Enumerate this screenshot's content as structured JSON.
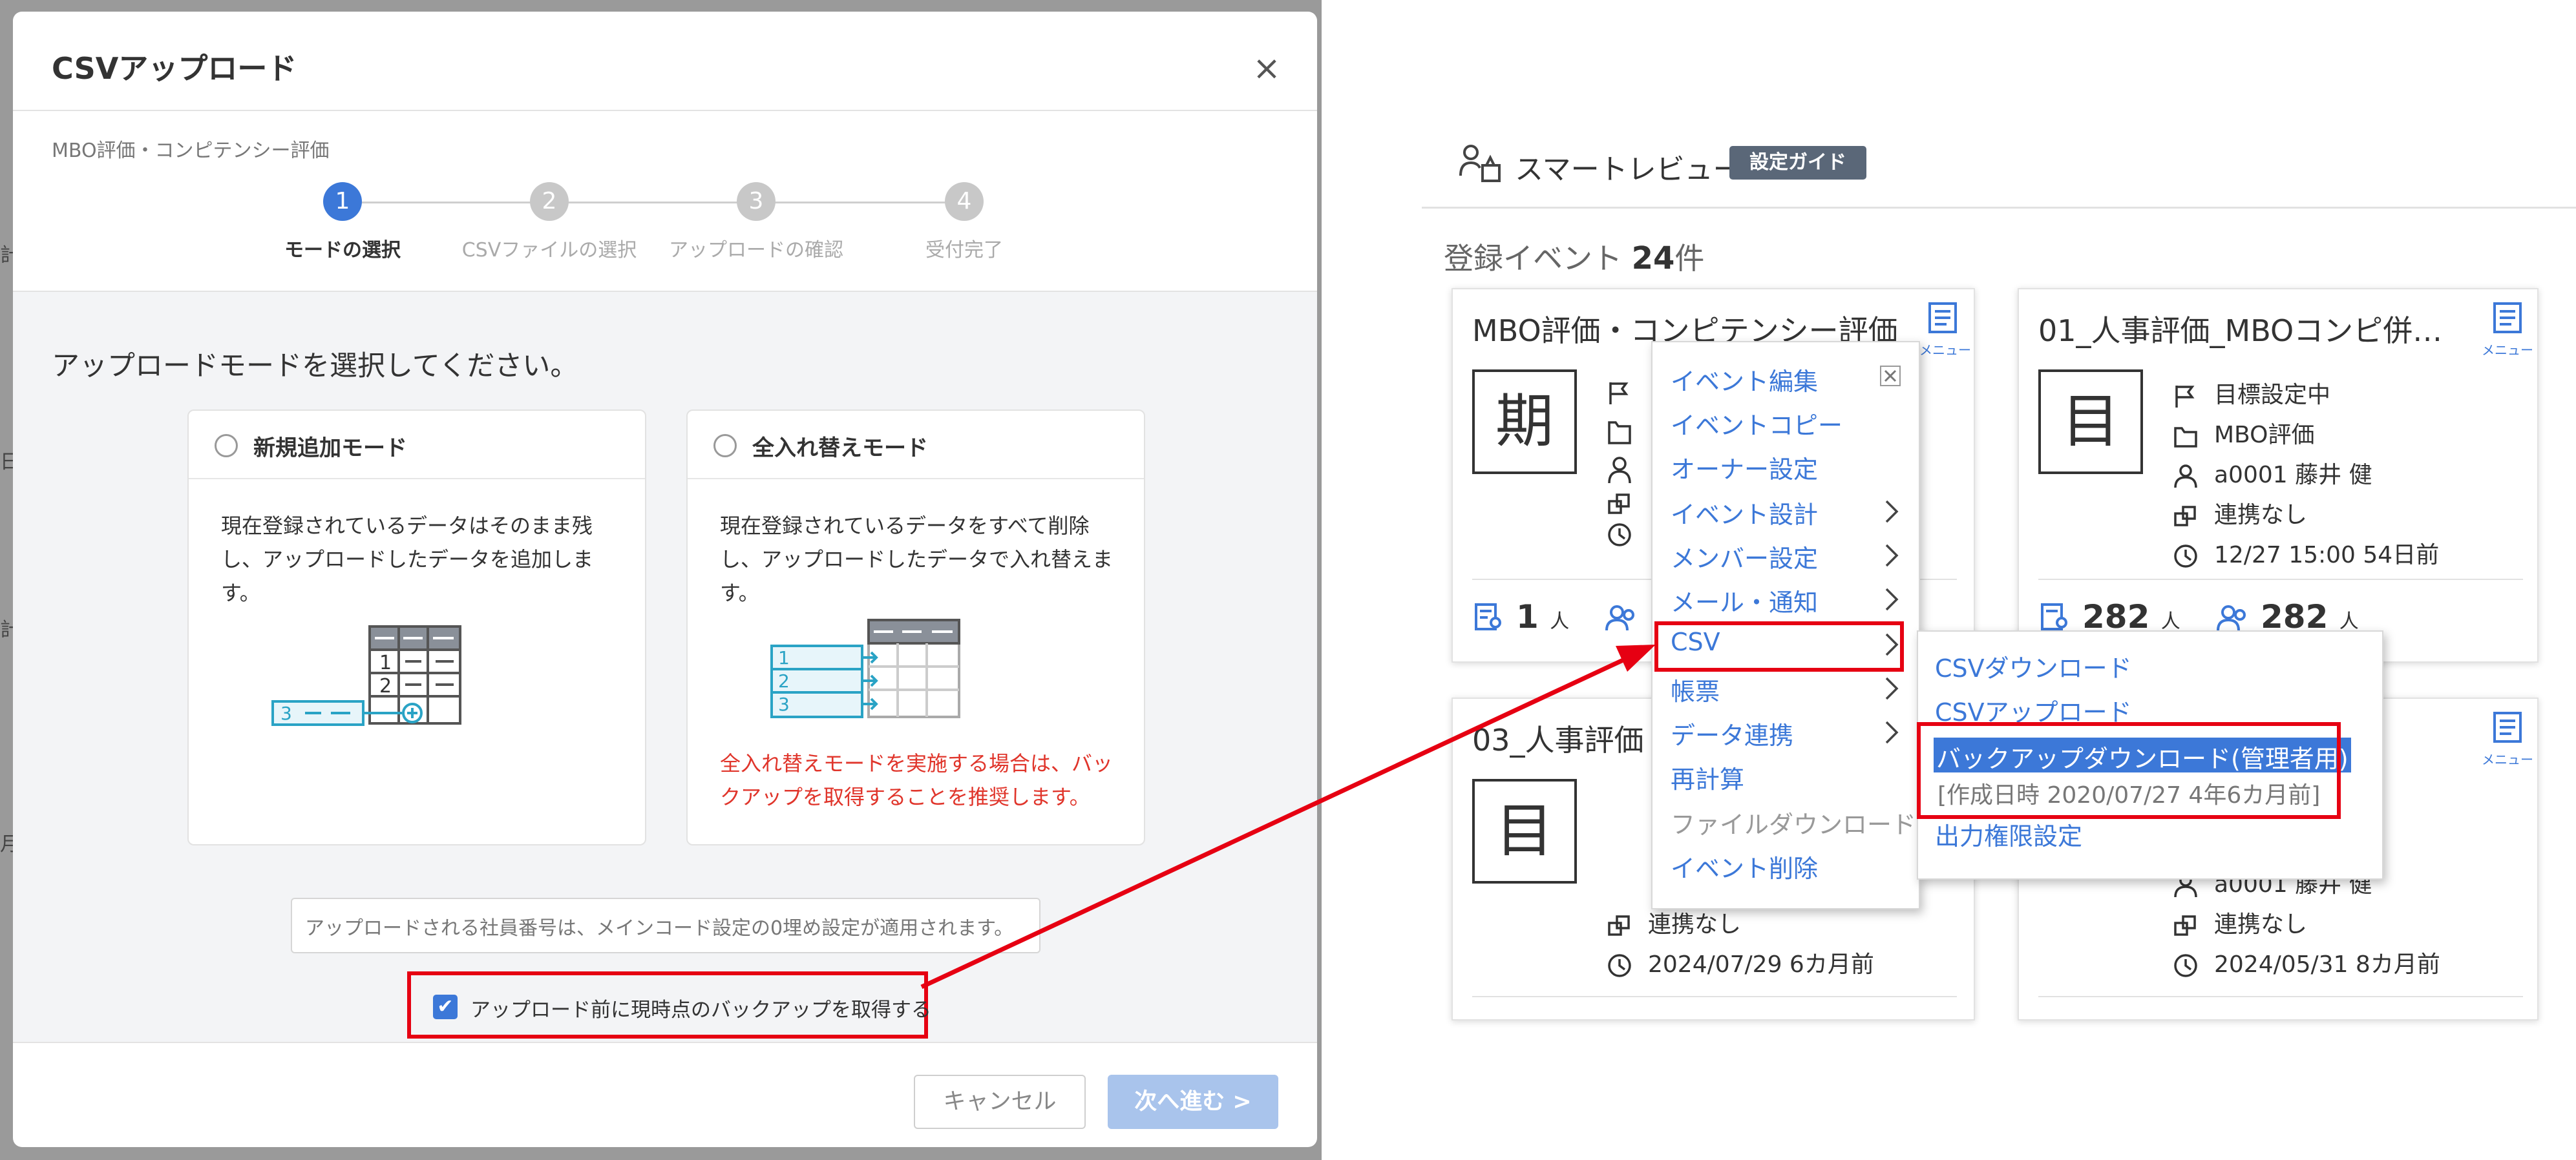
{
  "background_app": {
    "edge_glyphs": [
      "計",
      "日",
      "計",
      "月"
    ]
  },
  "modal": {
    "title": "CSVアップロード",
    "close_glyph": "×",
    "breadcrumb": "MBO評価・コンピテンシー評価",
    "steps": [
      {
        "number": "1",
        "label": "モードの選択",
        "active": true
      },
      {
        "number": "2",
        "label": "CSVファイルの選択",
        "active": false
      },
      {
        "number": "3",
        "label": "アップロードの確認",
        "active": false
      },
      {
        "number": "4",
        "label": "受付完了",
        "active": false
      }
    ],
    "prompt": "アップロードモードを選択してください。",
    "modes": [
      {
        "title": "新規追加モード",
        "description": "現在登録されているデータはそのまま残し、アップロードしたデータを追加します。",
        "warning": ""
      },
      {
        "title": "全入れ替えモード",
        "description": "現在登録されているデータをすべて削除し、アップロードしたデータで入れ替えます。",
        "warning": "全入れ替えモードを実施する場合は、バックアップを取得することを推奨します。"
      }
    ],
    "diagram_labels": {
      "add": [
        "1",
        "2",
        "3"
      ],
      "replace": [
        "1",
        "2",
        "3"
      ]
    },
    "note": "アップロードされる社員番号は、メインコード設定の0埋め設定が適用されます。",
    "backup_checkbox": {
      "label": "アップロード前に現時点のバックアップを取得する",
      "checked": true
    },
    "cancel_label": "キャンセル",
    "next_label": "次へ進む >"
  },
  "smart_review": {
    "title": "スマートレビュー",
    "guide_badge": "設定ガイド",
    "count_prefix": "登録イベント",
    "count": "24",
    "count_suffix": "件",
    "menu_label": "メニュー",
    "cards": [
      {
        "title": "MBO評価・コンピテンシー評価",
        "kanji": "期",
        "stat_left_value": "1",
        "stat_left_unit": "人"
      },
      {
        "title": "01_人事評価_MBOコンピ併…",
        "kanji": "目",
        "status": "目標設定中",
        "folder": "MBO評価",
        "owner": "a0001 藤井 健",
        "link": "連携なし",
        "time": "12/27 15:00 54日前",
        "stat_left_value": "282",
        "stat_left_unit": "人",
        "stat_right_value": "282",
        "stat_right_unit": "人"
      },
      {
        "title": "03_人事評価",
        "kanji": "目",
        "link": "連携なし",
        "time": "2024/07/29 6カ月前"
      },
      {
        "owner": "a0001 藤井 健",
        "link": "連携なし",
        "time": "2024/05/31 8カ月前"
      }
    ],
    "context_menu": [
      {
        "label": "イベント編集",
        "submenu": false,
        "disabled": false
      },
      {
        "label": "イベントコピー",
        "submenu": false,
        "disabled": false
      },
      {
        "label": "オーナー設定",
        "submenu": false,
        "disabled": false
      },
      {
        "label": "イベント設計",
        "submenu": true,
        "disabled": false
      },
      {
        "label": "メンバー設定",
        "submenu": true,
        "disabled": false
      },
      {
        "label": "メール・通知",
        "submenu": true,
        "disabled": false
      },
      {
        "label": "CSV",
        "submenu": true,
        "disabled": false
      },
      {
        "label": "帳票",
        "submenu": true,
        "disabled": false
      },
      {
        "label": "データ連携",
        "submenu": true,
        "disabled": false
      },
      {
        "label": "再計算",
        "submenu": false,
        "disabled": false
      },
      {
        "label": "ファイルダウンロード",
        "submenu": false,
        "disabled": true
      },
      {
        "label": "イベント削除",
        "submenu": false,
        "disabled": false
      }
    ],
    "csv_submenu": {
      "download": "CSVダウンロード",
      "upload": "CSVアップロード",
      "backup_download": "バックアップダウンロード(管理者用)",
      "backup_date": "[作成日時 2020/07/27 4年6カ月前]",
      "permission": "出力権限設定"
    }
  },
  "colors": {
    "accent": "#3c78d8",
    "highlight": "#e60012",
    "warning": "#e0352b",
    "badge": "#5a6778"
  }
}
